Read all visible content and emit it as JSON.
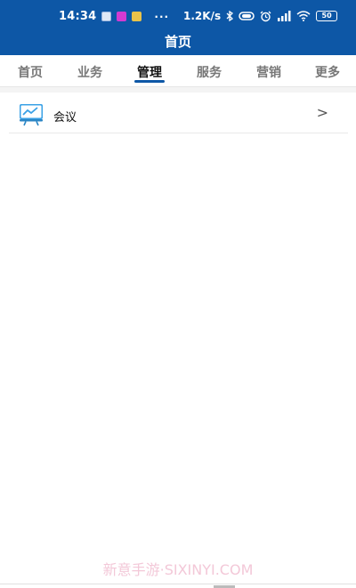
{
  "status_bar": {
    "time": "14:34",
    "more": "···",
    "speed": "1.2K/s",
    "battery": "50"
  },
  "header": {
    "title": "首页",
    "bg_color": "#0d57a6"
  },
  "tabs": [
    {
      "label": "首页"
    },
    {
      "label": "业务"
    },
    {
      "label": "管理",
      "active": true
    },
    {
      "label": "服务"
    },
    {
      "label": "营销"
    },
    {
      "label": "更多"
    }
  ],
  "list": {
    "items": [
      {
        "label": "会议",
        "icon": "presentation-chart-icon"
      }
    ]
  },
  "watermark": "新意手游·SIXINYI.COM"
}
